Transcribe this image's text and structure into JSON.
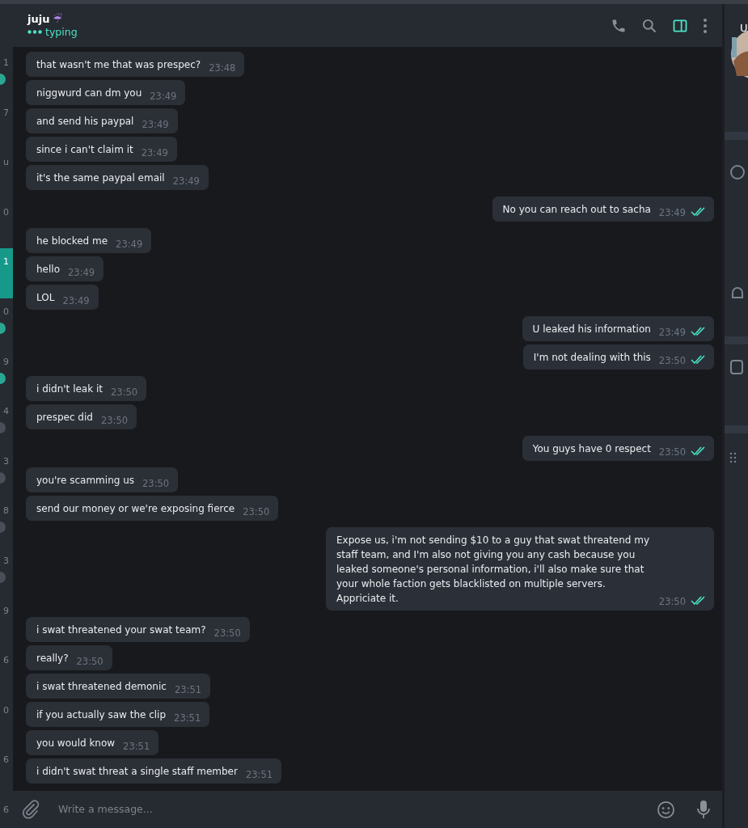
{
  "sidebar_strip": {
    "items": [
      {
        "text": "1",
        "color": "#2aa792",
        "selected": false
      },
      {
        "text": "7",
        "selected": false
      },
      {
        "text": "u",
        "selected": false
      },
      {
        "text": "0",
        "selected": false
      },
      {
        "text": "1",
        "selected": true
      },
      {
        "text": "0",
        "color": "#2aa792",
        "selected": false
      },
      {
        "text": "9",
        "color": "#2aa792",
        "selected": false
      },
      {
        "text": "4",
        "color": "#4a4f57",
        "selected": false
      },
      {
        "text": "3",
        "color": "#4a4f57",
        "selected": false
      },
      {
        "text": "8",
        "color": "#4a4f57",
        "selected": false
      },
      {
        "text": "3",
        "color": "#4a4f57",
        "selected": false
      },
      {
        "text": "9",
        "selected": false
      },
      {
        "text": "6",
        "selected": false
      },
      {
        "text": "0",
        "selected": false
      },
      {
        "text": "6",
        "selected": false
      },
      {
        "text": "6",
        "selected": false
      }
    ]
  },
  "header": {
    "name": "juju",
    "emoji": "☔",
    "status": "typing",
    "panel_open": true
  },
  "messages": [
    {
      "text": "that wasn't me that was prespec?",
      "time": "23:48",
      "outgoing": false
    },
    {
      "text": "niggwurd can dm you",
      "time": "23:49",
      "outgoing": false
    },
    {
      "text": "and send his paypal",
      "time": "23:49",
      "outgoing": false
    },
    {
      "text": "since i can't claim it",
      "time": "23:49",
      "outgoing": false
    },
    {
      "text": "it's the same paypal email",
      "time": "23:49",
      "outgoing": false
    },
    {
      "text": "No you can reach out to sacha",
      "time": "23:49",
      "outgoing": true,
      "read": true
    },
    {
      "text": "he blocked me",
      "time": "23:49",
      "outgoing": false
    },
    {
      "text": "hello",
      "time": "23:49",
      "outgoing": false
    },
    {
      "text": "LOL",
      "time": "23:49",
      "outgoing": false
    },
    {
      "text": "U leaked his information",
      "time": "23:49",
      "outgoing": true,
      "read": true
    },
    {
      "text": "I'm not dealing with this",
      "time": "23:50",
      "outgoing": true,
      "read": true
    },
    {
      "text": "i didn't leak it",
      "time": "23:50",
      "outgoing": false
    },
    {
      "text": "prespec did",
      "time": "23:50",
      "outgoing": false
    },
    {
      "text": "You guys have 0 respect",
      "time": "23:50",
      "outgoing": true,
      "read": true
    },
    {
      "text": "you're scamming us",
      "time": "23:50",
      "outgoing": false
    },
    {
      "text": "send our money or we're exposing fierce",
      "time": "23:50",
      "outgoing": false
    },
    {
      "text": "Expose us, i'm not sending $10 to a guy that swat threatend my staff team, and I'm also not giving you any cash because you leaked someone's personal information, i'll also make sure that your whole faction gets blacklisted on multiple servers. Appriciate it.",
      "time": "23:50",
      "outgoing": true,
      "read": true
    },
    {
      "text": "i swat threatened your swat team?",
      "time": "23:50",
      "outgoing": false
    },
    {
      "text": "really?",
      "time": "23:50",
      "outgoing": false
    },
    {
      "text": "i swat threatened demonic",
      "time": "23:51",
      "outgoing": false
    },
    {
      "text": "if you actually saw the clip",
      "time": "23:51",
      "outgoing": false
    },
    {
      "text": "you would know",
      "time": "23:51",
      "outgoing": false
    },
    {
      "text": "i didn't swat threat a single staff member",
      "time": "23:51",
      "outgoing": false
    }
  ],
  "composer": {
    "placeholder": "Write a message..."
  },
  "right_panel": {
    "title": "U"
  }
}
